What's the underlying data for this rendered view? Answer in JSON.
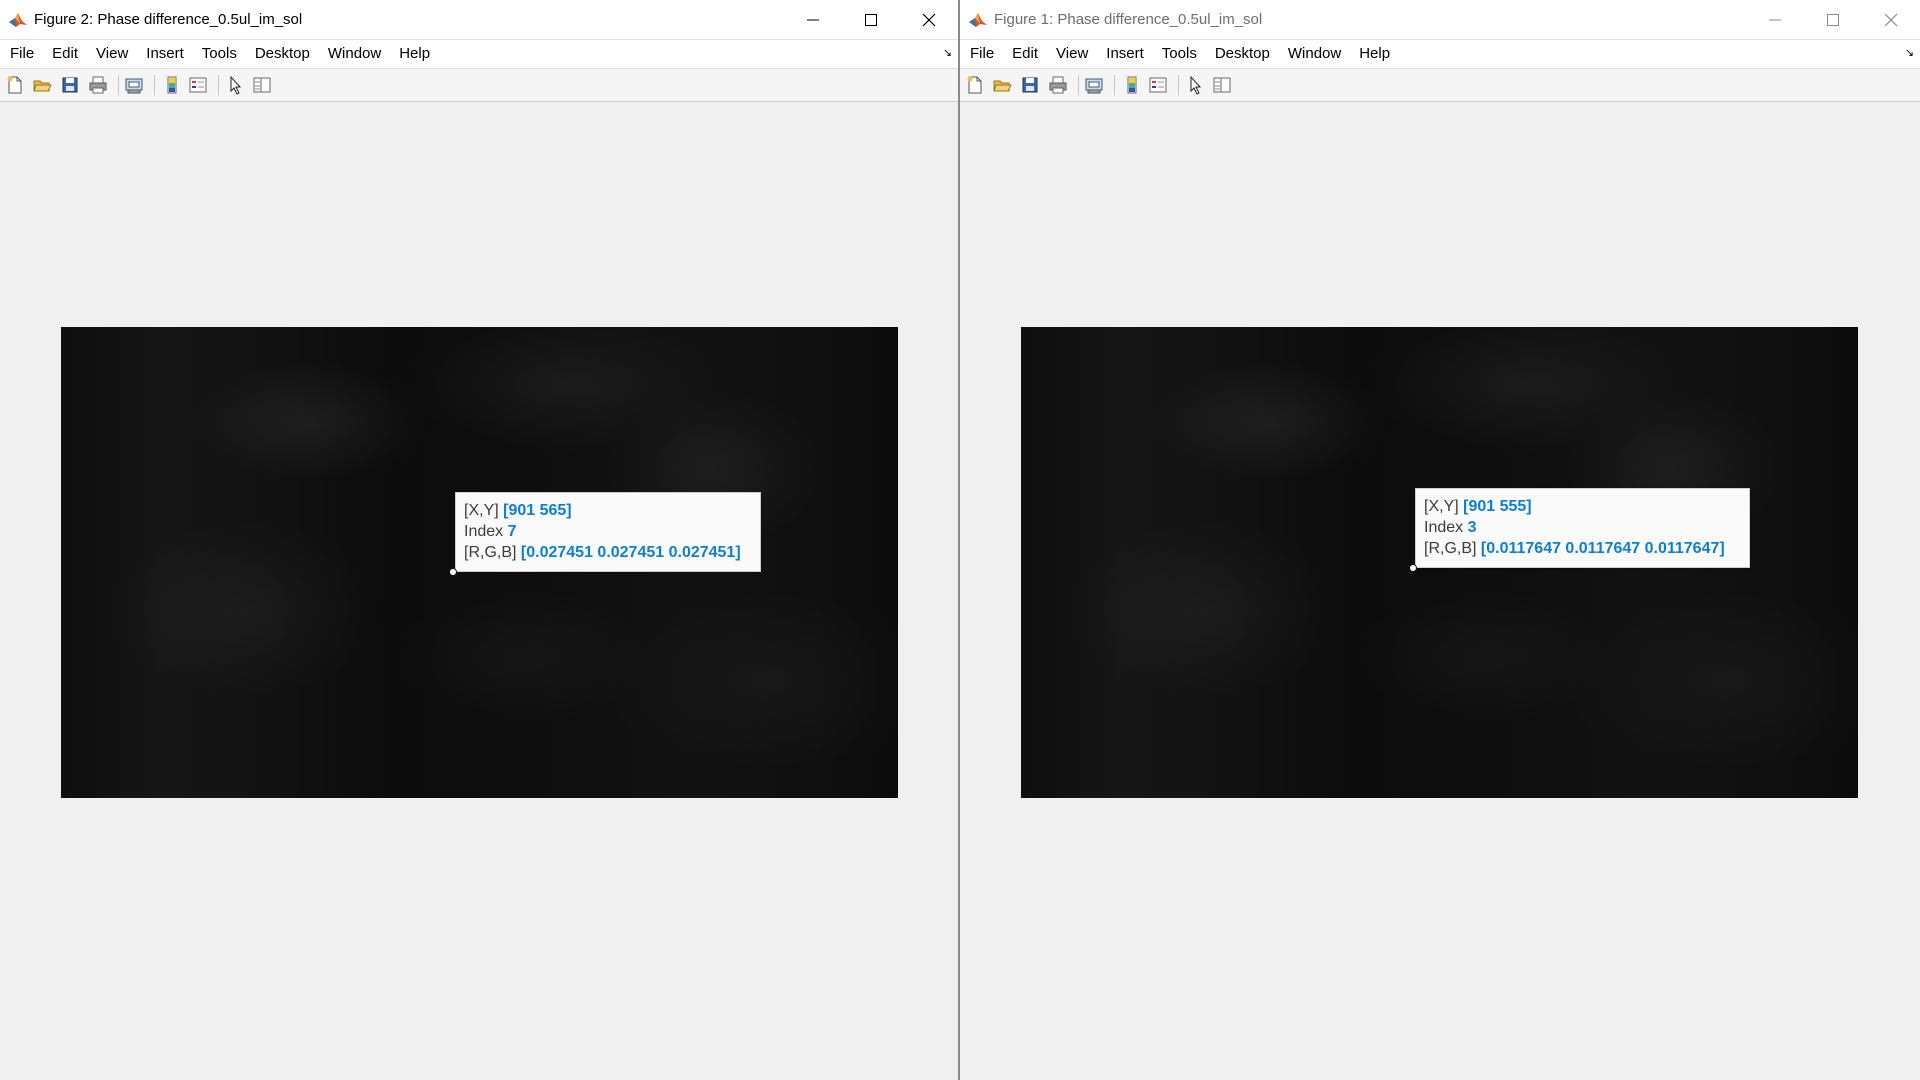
{
  "windows": [
    {
      "id": "win2",
      "title": "Figure 2: Phase difference_0.5ul_im_sol",
      "active": true,
      "datatip": {
        "xy_label": "[X,Y]",
        "xy_value": "[901 565]",
        "index_label": "Index",
        "index_value": "7",
        "rgb_label": "[R,G,B]",
        "rgb_value": "[0.027451 0.027451 0.027451]"
      }
    },
    {
      "id": "win1",
      "title": "Figure 1: Phase difference_0.5ul_im_sol",
      "active": false,
      "datatip": {
        "xy_label": "[X,Y]",
        "xy_value": "[901 555]",
        "index_label": "Index",
        "index_value": "3",
        "rgb_label": "[R,G,B]",
        "rgb_value": "[0.0117647 0.0117647 0.0117647]"
      }
    }
  ],
  "menu": [
    "File",
    "Edit",
    "View",
    "Insert",
    "Tools",
    "Desktop",
    "Window",
    "Help"
  ],
  "toolbar_icons": [
    "new-figure-icon",
    "open-file-icon",
    "save-icon",
    "print-icon",
    "print-preview-icon",
    "colorbar-icon",
    "legend-icon",
    "edit-plot-icon",
    "property-inspector-icon"
  ],
  "colors": {
    "datatip_value": "#0b7fd6",
    "title_icon": "#d9531e"
  }
}
